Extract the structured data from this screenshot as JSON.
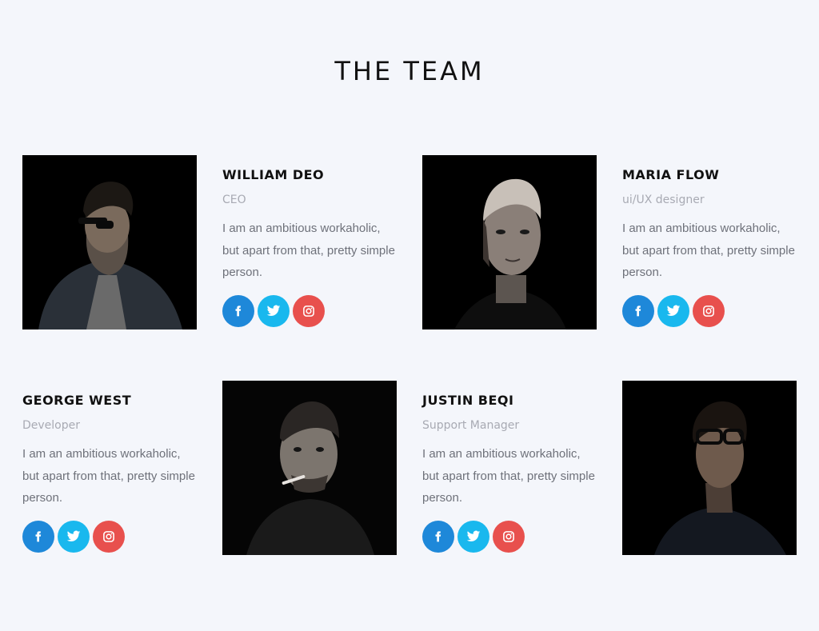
{
  "section": {
    "title": "THE TEAM"
  },
  "colors": {
    "background": "#f4f6fb",
    "facebook": "#1e88d9",
    "twitter": "#19b8ee",
    "instagram": "#e8504d",
    "name": "#111111",
    "role": "#a8aab3",
    "bio": "#6e717a"
  },
  "members": [
    {
      "name": "WILLIAM DEO",
      "role": "CEO",
      "bio": "I am an ambitious workaholic, but apart from that, pretty simple person.",
      "socials": [
        "facebook-icon",
        "twitter-icon",
        "instagram-icon"
      ]
    },
    {
      "name": "MARIA FLOW",
      "role": "ui/UX designer",
      "bio": "I am an ambitious workaholic, but apart from that, pretty simple person.",
      "socials": [
        "facebook-icon",
        "twitter-icon",
        "instagram-icon"
      ]
    },
    {
      "name": "GEORGE WEST",
      "role": "Developer",
      "bio": "I am an ambitious workaholic, but apart from that, pretty simple person.",
      "socials": [
        "facebook-icon",
        "twitter-icon",
        "instagram-icon"
      ]
    },
    {
      "name": "JUSTIN BEQI",
      "role": "Support Manager",
      "bio": "I am an ambitious workaholic, but apart from that, pretty simple person.",
      "socials": [
        "facebook-icon",
        "twitter-icon",
        "instagram-icon"
      ]
    }
  ]
}
